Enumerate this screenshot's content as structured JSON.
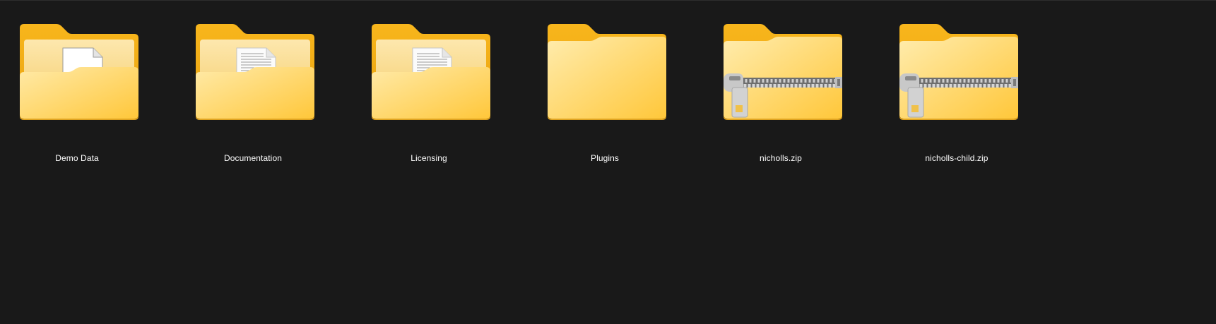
{
  "explorer": {
    "items": [
      {
        "label": "Demo Data",
        "kind": "folder-blank-doc",
        "icon": "folder-with-document-icon"
      },
      {
        "label": "Documentation",
        "kind": "folder-text-doc",
        "icon": "folder-with-text-document-icon"
      },
      {
        "label": "Licensing",
        "kind": "folder-text-doc",
        "icon": "folder-with-text-document-icon"
      },
      {
        "label": "Plugins",
        "kind": "folder-empty",
        "icon": "folder-icon"
      },
      {
        "label": "nicholls.zip",
        "kind": "zip",
        "icon": "zip-folder-icon"
      },
      {
        "label": "nicholls-child.zip",
        "kind": "zip",
        "icon": "zip-folder-icon"
      }
    ]
  },
  "colors": {
    "background": "#191919",
    "folder_back": "#f5b21c",
    "folder_front_light": "#ffe9a3",
    "folder_front_dark": "#ffc83d",
    "label_text": "#ffffff"
  }
}
